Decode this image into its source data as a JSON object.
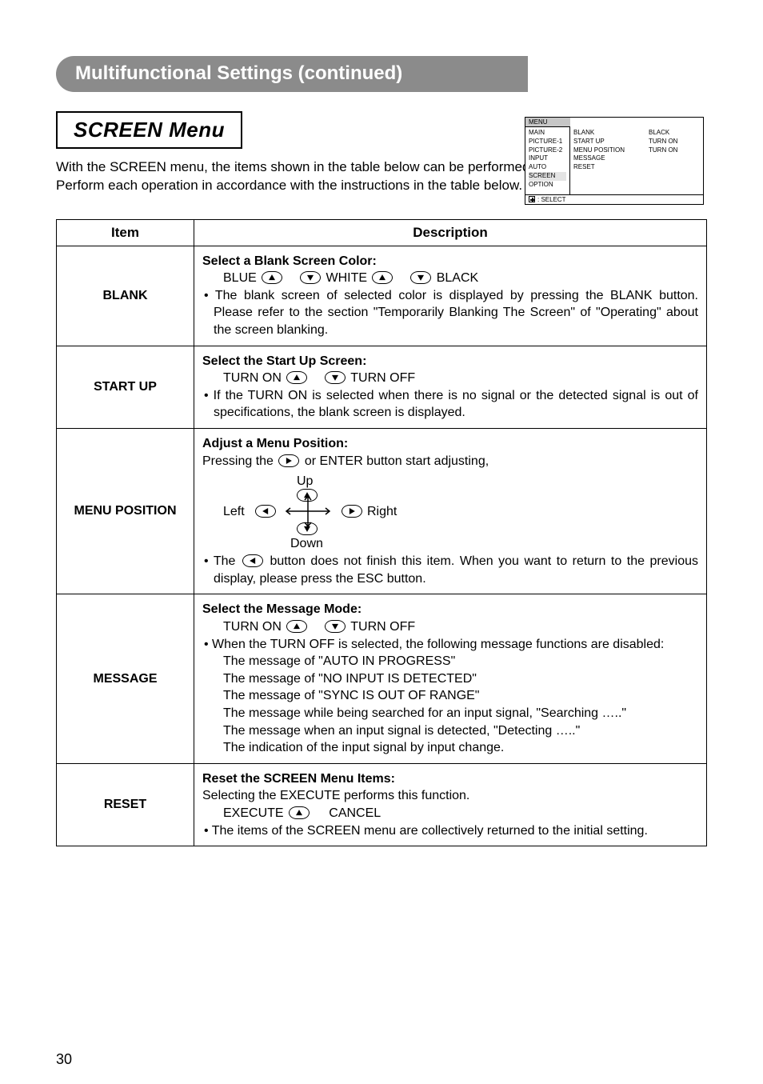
{
  "header": "Multifunctional Settings (continued)",
  "section_title": "SCREEN Menu",
  "intro_p1": "With the SCREEN menu, the items shown in the table below can be performed.",
  "intro_p2": "Perform each operation in accordance with the instructions in the table below.",
  "mini_menu": {
    "label": "MENU",
    "col1": [
      "MAIN",
      "PICTURE-1",
      "PICTURE-2",
      "INPUT",
      "AUTO",
      "SCREEN",
      "OPTION"
    ],
    "col2": [
      "BLANK",
      "START UP",
      "MENU POSITION",
      "MESSAGE",
      "RESET"
    ],
    "col3": [
      "BLACK",
      "TURN ON",
      "",
      "TURN ON",
      ""
    ],
    "selected_index": 5,
    "footer": ": SELECT"
  },
  "table": {
    "head_item": "Item",
    "head_desc": "Description",
    "rows": [
      {
        "item": "BLANK",
        "title": "Select a Blank Screen Color:",
        "opt_left": "BLUE",
        "opt_mid": "WHITE",
        "opt_right": "BLACK",
        "bullet": "• The blank screen of selected color is displayed by pressing the BLANK button. Please refer to the section \"Temporarily Blanking The Screen\" of \"Operating\" about the screen blanking."
      },
      {
        "item": "START UP",
        "title": "Select the Start Up Screen:",
        "opt_left": "TURN ON",
        "opt_right": "TURN OFF",
        "bullet": "• If the TURN ON is selected when there is no signal or the detected signal is out of specifications, the blank screen is displayed."
      },
      {
        "item": "MENU POSITION",
        "title": "Adjust a Menu Position:",
        "line1_a": "Pressing the",
        "line1_b": "or ENTER button start adjusting,",
        "labels": {
          "up": "Up",
          "down": "Down",
          "left": "Left",
          "right": "Right"
        },
        "bullet_a": "• The",
        "bullet_b": "button does not finish this item. When you want to return to the previous display, please press the ESC button."
      },
      {
        "item": "MESSAGE",
        "title": "Select the Message Mode:",
        "opt_left": "TURN ON",
        "opt_right": "TURN OFF",
        "bullet": "• When the TURN OFF is selected, the following message functions are disabled:",
        "lines": [
          "The message of \"AUTO IN PROGRESS\"",
          "The message of \"NO INPUT IS DETECTED\"",
          "The message of \"SYNC IS OUT OF RANGE\"",
          "The message while being searched for an input signal, \"Searching …..\"",
          "The message when an input signal is detected, \"Detecting …..\"",
          "The indication of the input signal by input change."
        ]
      },
      {
        "item": "RESET",
        "title": "Reset the SCREEN Menu Items:",
        "line1": "Selecting the EXECUTE performs this function.",
        "opt_left": "EXECUTE",
        "opt_right": "CANCEL",
        "bullet": "• The items of the SCREEN menu are collectively returned to the initial setting."
      }
    ]
  },
  "page_number": "30"
}
